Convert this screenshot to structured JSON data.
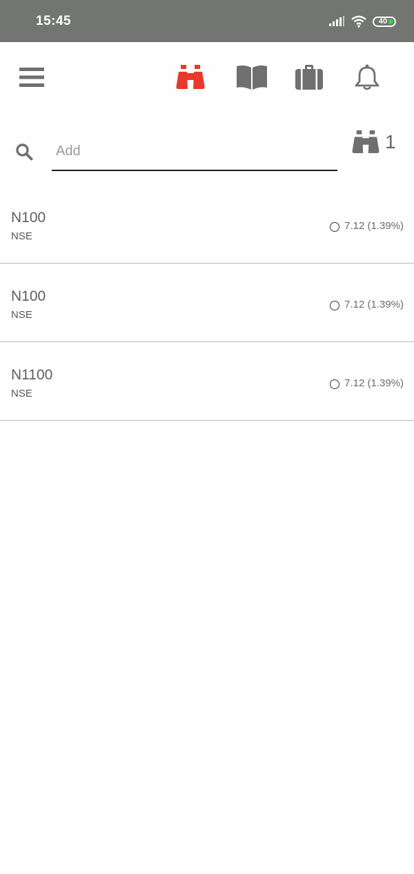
{
  "status_bar": {
    "time": "15:45",
    "battery": "40",
    "battery_color": "#36d246"
  },
  "toolbar": {
    "menu_icon": "hamburger-menu-icon",
    "tabs": [
      {
        "icon": "binoculars-icon",
        "active": true,
        "color": "#e8392c"
      },
      {
        "icon": "open-book-icon",
        "active": false,
        "color": "#6f6f6f"
      },
      {
        "icon": "briefcase-icon",
        "active": false,
        "color": "#6f6f6f"
      },
      {
        "icon": "bell-icon",
        "active": false,
        "color": "#6f6f6f"
      }
    ]
  },
  "search": {
    "placeholder": "Add",
    "value": "",
    "watchlist_number": "1"
  },
  "rows": [
    {
      "symbol": "N100",
      "exchange": "NSE",
      "change": "7.12 (1.39%)"
    },
    {
      "symbol": "N100",
      "exchange": "NSE",
      "change": "7.12 (1.39%)"
    },
    {
      "symbol": "N1100",
      "exchange": "NSE",
      "change": "7.12 (1.39%)"
    }
  ]
}
